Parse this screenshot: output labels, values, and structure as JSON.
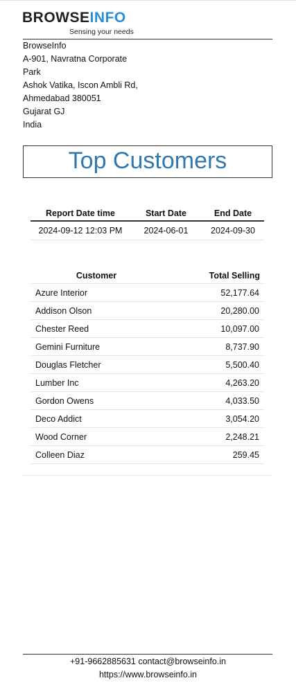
{
  "logo": {
    "brand_dark": "BROWSE",
    "brand_accent": "INFO",
    "tagline": "Sensing your needs"
  },
  "company_address": [
    "BrowseInfo",
    "A-901, Navratna Corporate",
    "Park",
    "Ashok Vatika, Iscon Ambli Rd,",
    "Ahmedabad 380051",
    "Gujarat GJ",
    "India"
  ],
  "report": {
    "title": "Top Customers"
  },
  "meta_table": {
    "headers": [
      "Report Date time",
      "Start Date",
      "End Date"
    ],
    "row": [
      "2024-09-12 12:03 PM",
      "2024-06-01",
      "2024-09-30"
    ]
  },
  "customer_table": {
    "headers": [
      "Customer",
      "Total Selling"
    ],
    "rows": [
      [
        "Azure Interior",
        "52,177.64"
      ],
      [
        "Addison Olson",
        "20,280.00"
      ],
      [
        "Chester Reed",
        "10,097.00"
      ],
      [
        "Gemini Furniture",
        "8,737.90"
      ],
      [
        "Douglas Fletcher",
        "5,500.40"
      ],
      [
        "Lumber Inc",
        "4,263.20"
      ],
      [
        "Gordon Owens",
        "4,033.50"
      ],
      [
        "Deco Addict",
        "3,054.20"
      ],
      [
        "Wood Corner",
        "2,248.21"
      ],
      [
        "Colleen Diaz",
        "259.45"
      ]
    ]
  },
  "footer": {
    "line1": "+91-9662885631 contact@browseinfo.in",
    "line2": "https://www.browseinfo.in"
  },
  "colors": {
    "title": "#2f79b0",
    "logo_accent": "#2a8fd3"
  }
}
